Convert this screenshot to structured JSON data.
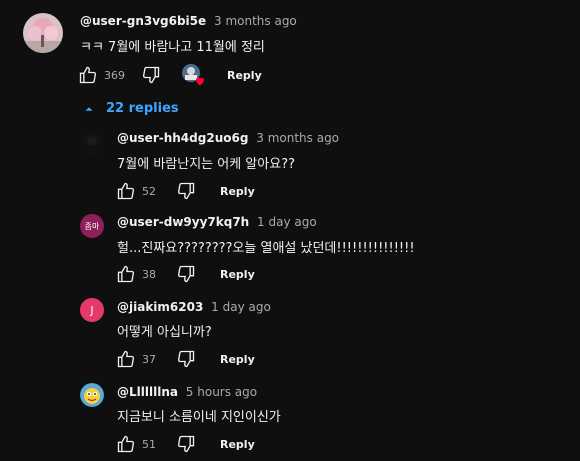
{
  "top_comment": {
    "author": "@user-gn3vg6bi5e",
    "time": "3 months ago",
    "text": "ㅋㅋ 7월에 바람나고 11월에 정리",
    "likes": "369",
    "reply_label": "Reply"
  },
  "replies_toggle": {
    "label": "22 replies"
  },
  "replies": [
    {
      "author": "@user-hh4dg2uo6g",
      "time": "3 months ago",
      "text": "7월에 바람난지는 어케 알아요??",
      "likes": "52",
      "reply_label": "Reply"
    },
    {
      "author": "@user-dw9yy7kq7h",
      "time": "1 day ago",
      "text": "헐...진짜요????????오늘 열애설 났던데!!!!!!!!!!!!!!!",
      "likes": "38",
      "reply_label": "Reply",
      "avatar_text": "좀마"
    },
    {
      "author": "@jiakim6203",
      "time": "1 day ago",
      "text": "어떻게 아십니까?",
      "likes": "37",
      "reply_label": "Reply",
      "avatar_text": "J"
    },
    {
      "author": "@Lllllllna",
      "time": "5 hours ago",
      "text": "지금보니 소름이네 지인이신가",
      "likes": "51",
      "reply_label": "Reply"
    }
  ],
  "colors": {
    "background": "#0f0f0f",
    "link": "#3ea6ff",
    "secondary_text": "#aaaaaa",
    "heart": "#ff0033"
  }
}
